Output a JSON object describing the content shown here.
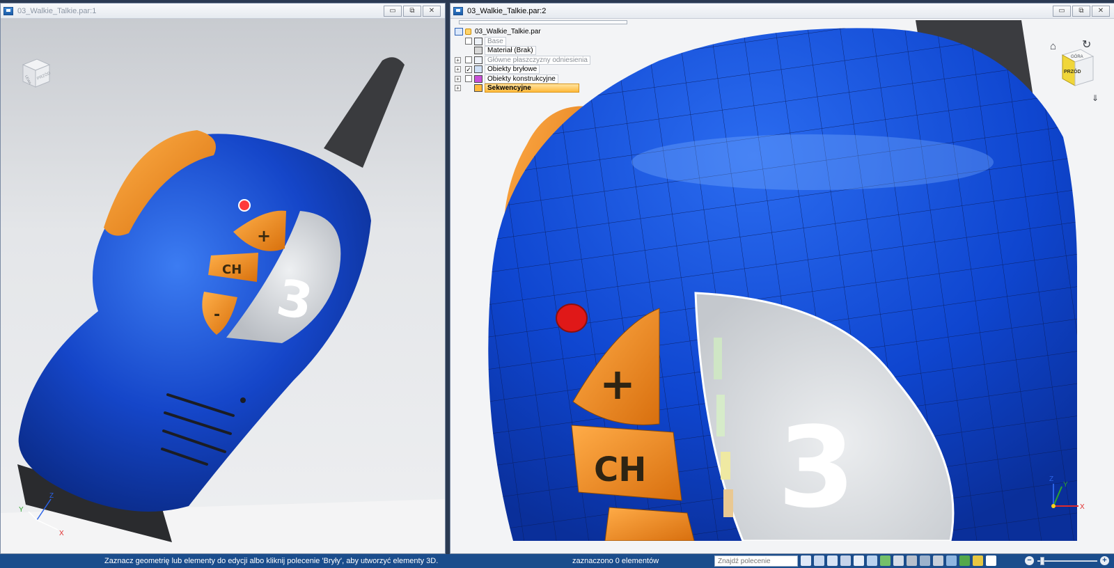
{
  "windows": {
    "left": {
      "title": "03_Walkie_Talkie.par:1",
      "cube": {
        "top_face": "",
        "left_face": "LEWA",
        "front_face": "PRZÓD"
      },
      "triad": {
        "x": "X",
        "y": "Y",
        "z": "Z"
      }
    },
    "right": {
      "title": "03_Walkie_Talkie.par:2",
      "cube": {
        "top_face": "GÓRA",
        "front_face": "PRZÓD"
      },
      "triad": {
        "x": "X",
        "y": "Y",
        "z": "Z"
      }
    },
    "buttons": {
      "minimize": "▭",
      "restore": "⧉",
      "close": "✕"
    }
  },
  "tree": {
    "root": "03_Walkie_Talkie.par",
    "items": [
      {
        "label": "Base",
        "expander": "",
        "checked": false,
        "dim": true
      },
      {
        "label": "Materiał (Brak)",
        "expander": "",
        "checked": null,
        "dim": false
      },
      {
        "label": "Główne płaszczyzny odniesienia",
        "expander": "+",
        "checked": false,
        "dim": true
      },
      {
        "label": "Obiekty bryłowe",
        "expander": "+",
        "checked": true,
        "dim": false
      },
      {
        "label": "Obiekty konstrukcyjne",
        "expander": "+",
        "checked": false,
        "dim": false
      },
      {
        "label": "Sekwencyjne",
        "expander": "+",
        "checked": null,
        "dim": false
      }
    ]
  },
  "model": {
    "plus": "+",
    "ch": "CH",
    "minus": "-",
    "channel": "3"
  },
  "status": {
    "message": "Zaznacz geometrię lub elementy do edycji albo kliknij polecenie 'Bryły', aby utworzyć elementy 3D.",
    "selection": "zaznaczono 0 elementów",
    "command_placeholder": "Znajdź polecenie",
    "zoom_minus": "−",
    "zoom_plus": "+"
  },
  "colors": {
    "body_blue": "#1546c9",
    "accent_orange": "#f08a1a",
    "status_bar": "#1b4d8c"
  }
}
